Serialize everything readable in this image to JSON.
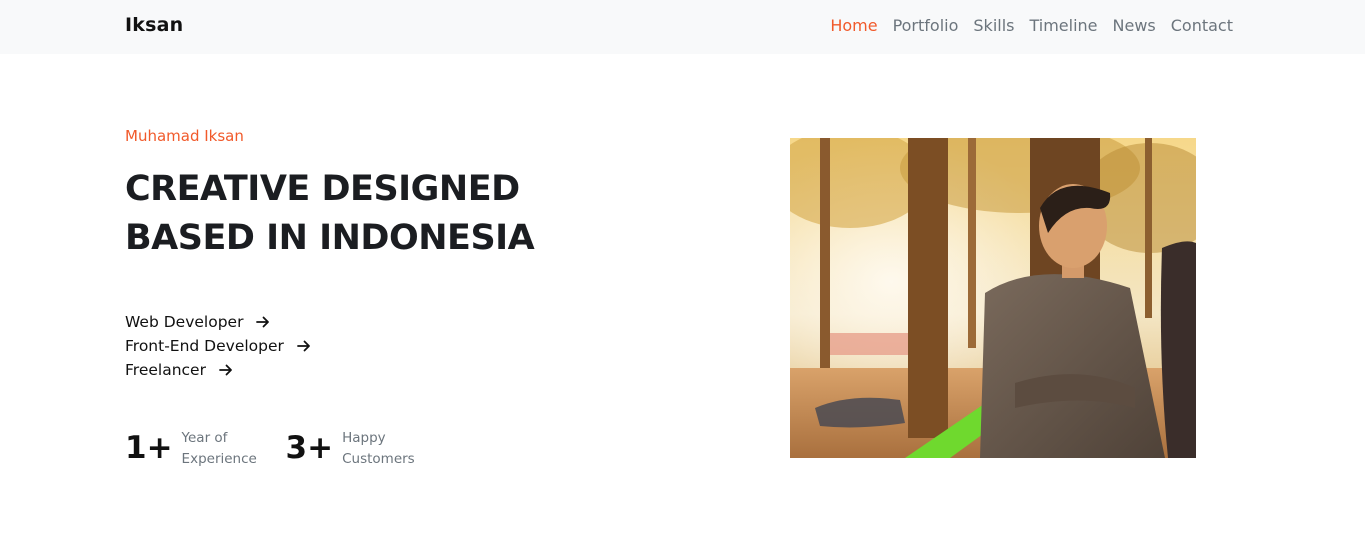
{
  "brand": "Iksan",
  "nav": {
    "home": "Home",
    "portfolio": "Portfolio",
    "skills": "Skills",
    "timeline": "Timeline",
    "news": "News",
    "contact": "Contact",
    "active": "Home"
  },
  "hero": {
    "name": "Muhamad Iksan",
    "title": "CREATIVE DESIGNED BASED IN INDONESIA",
    "roles": [
      "Web Developer",
      "Front-End Developer",
      "Freelancer"
    ],
    "stats": [
      {
        "value": "1+",
        "label": "Year of Experience"
      },
      {
        "value": "3+",
        "label": "Happy Customers"
      }
    ]
  },
  "colors": {
    "accent": "#f15a2b",
    "navbar_bg": "#f8f9fa",
    "muted": "#6c757d"
  },
  "icons": {
    "role_arrow": "arrow-right-icon"
  }
}
